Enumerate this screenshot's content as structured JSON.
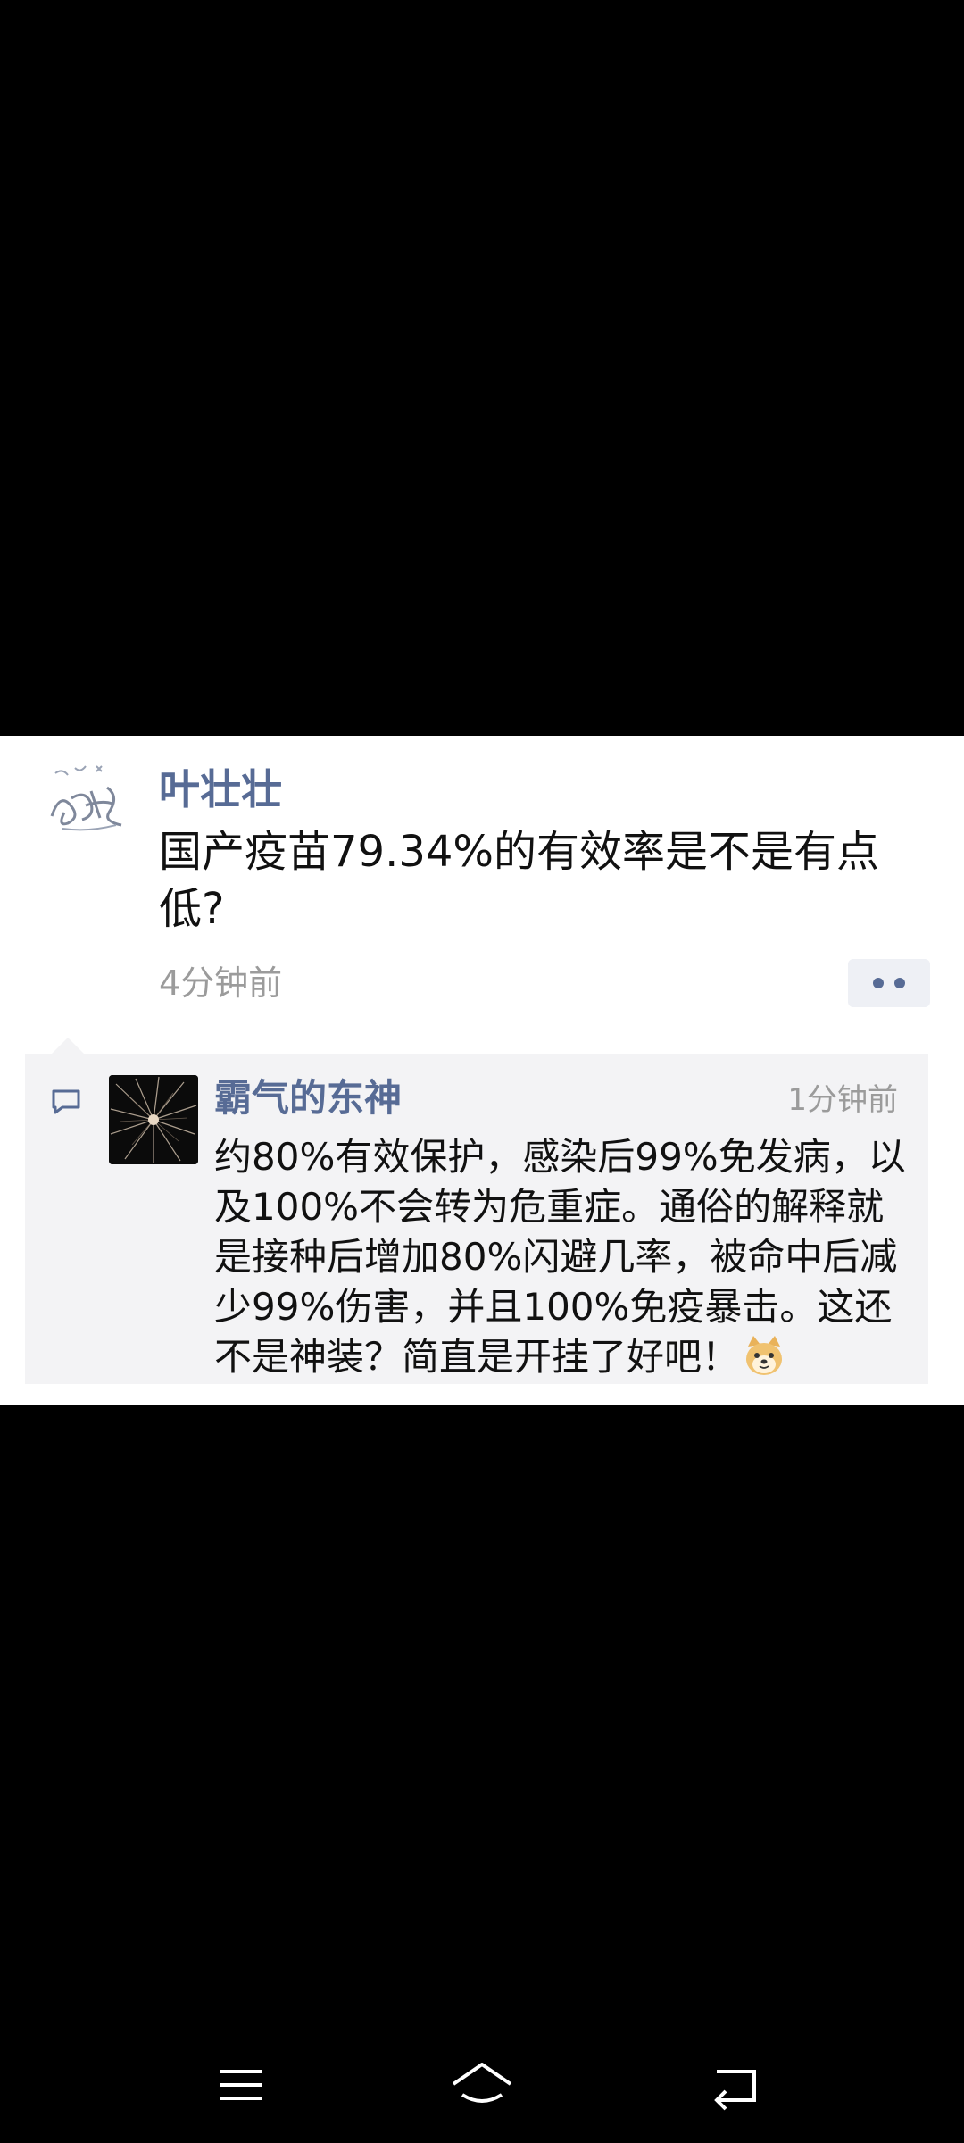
{
  "post": {
    "author": "叶壮壮",
    "text": "国产疫苗79.34%的有效率是不是有点低?",
    "time": "4分钟前",
    "avatar_icon": "signature-avatar-icon",
    "more_icon": "more-dots-icon"
  },
  "comment": {
    "icon": "comment-bubble-icon",
    "author": "霸气的东神",
    "time": "1分钟前",
    "text": "约80%有效保护，感染后99%免发病，以及100%不会转为危重症。通俗的解释就是接种后增加80%闪避几率，被命中后减少99%伤害，并且100%免疫暴击。这还不是神装？简直是开挂了好吧！",
    "emoji": "doge-emoji-icon",
    "avatar_icon": "firework-avatar-icon"
  },
  "navigation": {
    "menu_icon": "menu-icon",
    "home_icon": "home-icon",
    "back_icon": "back-icon"
  },
  "colors": {
    "link_blue": "#576b95",
    "gray_text": "#9b9b9b",
    "comment_bg": "#f3f3f5"
  }
}
